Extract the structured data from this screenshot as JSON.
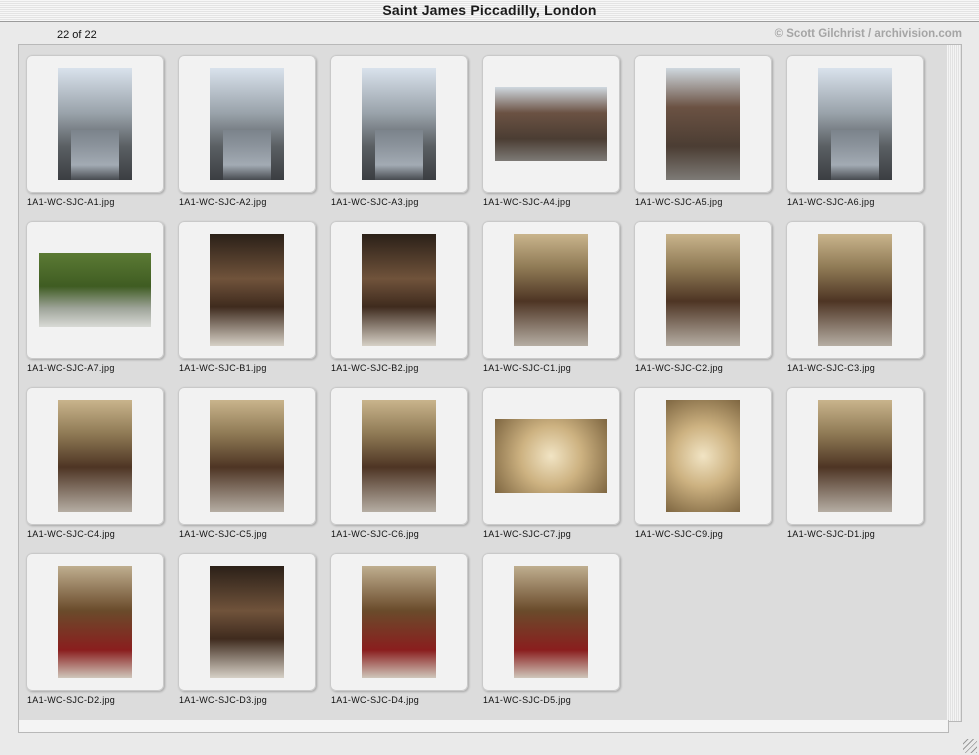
{
  "window": {
    "title": "Saint James Piccadilly, London"
  },
  "info": {
    "count": "22 of 22",
    "credit": "© Scott Gilchrist / archivision.com"
  },
  "thumbnails": [
    {
      "label": "1A1-WC-SJC-A1.jpg",
      "style": "street",
      "orientation": "portrait"
    },
    {
      "label": "1A1-WC-SJC-A2.jpg",
      "style": "street",
      "orientation": "portrait"
    },
    {
      "label": "1A1-WC-SJC-A3.jpg",
      "style": "street",
      "orientation": "portrait"
    },
    {
      "label": "1A1-WC-SJC-A4.jpg",
      "style": "church-ext",
      "orientation": "landscape"
    },
    {
      "label": "1A1-WC-SJC-A5.jpg",
      "style": "church-ext",
      "orientation": "portrait"
    },
    {
      "label": "1A1-WC-SJC-A6.jpg",
      "style": "street",
      "orientation": "portrait"
    },
    {
      "label": "1A1-WC-SJC-A7.jpg",
      "style": "garden",
      "orientation": "landscape"
    },
    {
      "label": "1A1-WC-SJC-B1.jpg",
      "style": "interior",
      "orientation": "portrait"
    },
    {
      "label": "1A1-WC-SJC-B2.jpg",
      "style": "interior",
      "orientation": "portrait"
    },
    {
      "label": "1A1-WC-SJC-C1.jpg",
      "style": "nave",
      "orientation": "portrait"
    },
    {
      "label": "1A1-WC-SJC-C2.jpg",
      "style": "nave",
      "orientation": "portrait"
    },
    {
      "label": "1A1-WC-SJC-C3.jpg",
      "style": "nave",
      "orientation": "portrait"
    },
    {
      "label": "1A1-WC-SJC-C4.jpg",
      "style": "nave",
      "orientation": "portrait"
    },
    {
      "label": "1A1-WC-SJC-C5.jpg",
      "style": "nave",
      "orientation": "portrait"
    },
    {
      "label": "1A1-WC-SJC-C6.jpg",
      "style": "nave",
      "orientation": "portrait"
    },
    {
      "label": "1A1-WC-SJC-C7.jpg",
      "style": "ceiling",
      "orientation": "landscape"
    },
    {
      "label": "1A1-WC-SJC-C9.jpg",
      "style": "ceiling",
      "orientation": "portrait"
    },
    {
      "label": "1A1-WC-SJC-D1.jpg",
      "style": "nave",
      "orientation": "portrait"
    },
    {
      "label": "1A1-WC-SJC-D2.jpg",
      "style": "altar",
      "orientation": "portrait"
    },
    {
      "label": "1A1-WC-SJC-D3.jpg",
      "style": "interior",
      "orientation": "portrait"
    },
    {
      "label": "1A1-WC-SJC-D4.jpg",
      "style": "altar",
      "orientation": "portrait"
    },
    {
      "label": "1A1-WC-SJC-D5.jpg",
      "style": "altar",
      "orientation": "portrait"
    }
  ]
}
